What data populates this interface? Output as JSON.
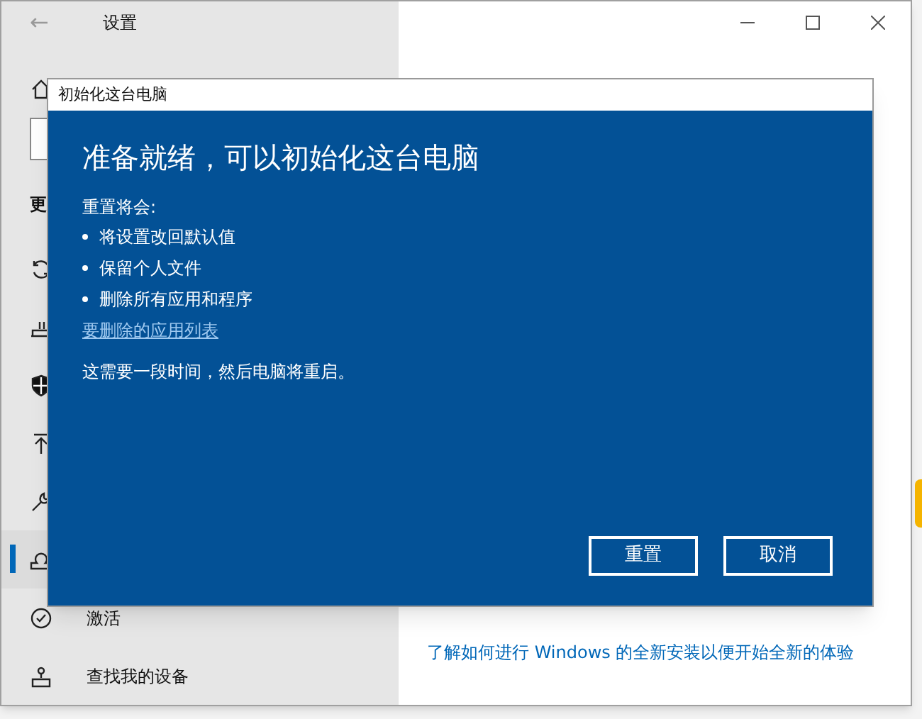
{
  "window": {
    "title": "设置",
    "back": "←"
  },
  "sidebar": {
    "section_fragment": "更",
    "items": [
      {
        "kind": "home",
        "selected": false
      },
      {
        "kind": "sync",
        "selected": false
      },
      {
        "kind": "delivery",
        "selected": false
      },
      {
        "kind": "shield",
        "selected": false
      },
      {
        "kind": "backup",
        "selected": false
      },
      {
        "kind": "wrench",
        "selected": false
      },
      {
        "kind": "recovery",
        "selected": true
      },
      {
        "kind": "check",
        "label": "激活",
        "selected": false
      },
      {
        "kind": "person",
        "label": "查找我的设备",
        "selected": false
      }
    ]
  },
  "content": {
    "link": "了解如何进行 Windows 的全新安装以便开始全新的体验"
  },
  "dialog": {
    "title": "初始化这台电脑",
    "heading": "准备就绪，可以初始化这台电脑",
    "intro": "重置将会:",
    "bullets": [
      "将设置改回默认值",
      "保留个人文件",
      "删除所有应用和程序"
    ],
    "link": "要删除的应用列表",
    "note": "这需要一段时间，然后电脑将重启。",
    "buttons": [
      "重置",
      "取消"
    ]
  }
}
